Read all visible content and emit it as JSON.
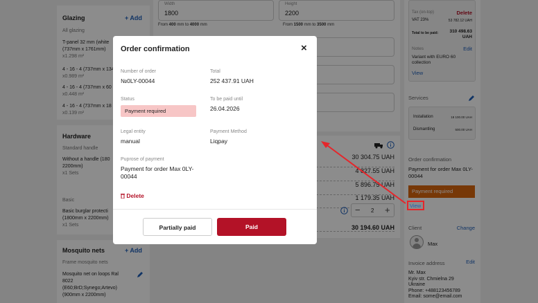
{
  "glazing": {
    "title": "Glazing",
    "add": "+ Add",
    "subtitle": "All glazing",
    "items": [
      {
        "name": "T-panel 32 mm (white",
        "dims": "(737mm x 1761mm)",
        "qty": "x1.298 m²"
      },
      {
        "name": "4 - 16 - 4 (737mm x 134",
        "qty": "x0.989 m²"
      },
      {
        "name": "4 - 16 - 4 (737mm x 60",
        "qty": "x0.448 m²"
      },
      {
        "name": "4 - 16 - 4 (737mm x 18",
        "qty": "x0.139 m²"
      }
    ]
  },
  "hardware": {
    "title": "Hardware",
    "standard": "Standard handle",
    "handle_name": "Without a handle (180",
    "handle_dims": "2200mm)",
    "handle_qty": "x1 Sets",
    "basic": "Basic",
    "basic_name": "Basic burglar protecti",
    "basic_dims": "(1800mm x 2200mm)",
    "basic_qty": "x1 Sets"
  },
  "mosquito": {
    "title": "Mosquito nets",
    "add": "+ Add",
    "frame": "Frame mosquito nets",
    "line1": "Mosquito net on loops Ral",
    "line2": "8022",
    "line3": "(E60;BrD;Synego;Artevo)",
    "line4": "(900mm x 2200mm)"
  },
  "dimensions": {
    "width_label": "Width",
    "width_value": "1800",
    "width_hint_pre": "From",
    "width_min": "400",
    "width_mid": "mm to",
    "width_max": "4000",
    "width_unit": "mm",
    "height_label": "Height",
    "height_value": "2200",
    "height_hint_pre": "From",
    "height_min": "1500",
    "height_mid": "mm to",
    "height_max": "3500",
    "height_unit": "mm"
  },
  "prices": {
    "rows": [
      "30 304.75 UAH",
      "4 827.55 UAH",
      "5 896.75 UAH",
      "1 179.35 UAH"
    ],
    "quantity": "2",
    "minus": "−",
    "plus": "+",
    "total": "30 194.60 UAH"
  },
  "summary": {
    "tax_label": "Tax (on-top)",
    "delete": "Delete",
    "vat_label": "VAT 23%",
    "vat_value": "53 782.12 UAH",
    "total_label": "Total to be paid:",
    "total_value": "310 498.63",
    "total_currency": "UAH",
    "notes_label": "Notes",
    "edit": "Edit",
    "notes_text": "Variant with EURO 60 collection",
    "view": "View"
  },
  "services": {
    "title": "Services",
    "installation_label": "Installation",
    "installation_value": "18 100.00 UAH",
    "dismantling_label": "Dismantling",
    "dismantling_value": "500.00 UAH"
  },
  "order_confirmation": {
    "title": "Order confirmation",
    "text": "Payment for order Max 0LY-00044",
    "status": "Payment required",
    "view": "View"
  },
  "client": {
    "title": "Client",
    "change": "Change",
    "name": "Max"
  },
  "invoice": {
    "title": "Invoice address",
    "edit": "Edit",
    "lines": [
      "Mr. Max",
      "Kyiv str. Chmielna 29",
      "Ukraine",
      "Phone: +488123456789",
      "Email: some@email.com"
    ]
  },
  "modal": {
    "title": "Order confirmation",
    "close": "×",
    "number_label": "Number of order",
    "number_value": "№0LY-00044",
    "total_label": "Total",
    "total_value": "252 437.91 UAH",
    "status_label": "Status",
    "status_value": "Payment required",
    "due_label": "To be paid until",
    "due_value": "26.04.2026",
    "legal_label": "Legal entity",
    "legal_value": "manual",
    "method_label": "Payment Method",
    "method_value": "Liqpay",
    "purpose_label": "Puprose of payment",
    "purpose_value": "Payment for order Max 0LY-00044",
    "delete": "Delete",
    "partially_paid": "Partially paid",
    "paid": "Paid"
  },
  "colors": {
    "accent": "#1f5fb8",
    "danger": "#b31227",
    "status_bg": "#f7c6c6",
    "orange": "#d9660e"
  }
}
